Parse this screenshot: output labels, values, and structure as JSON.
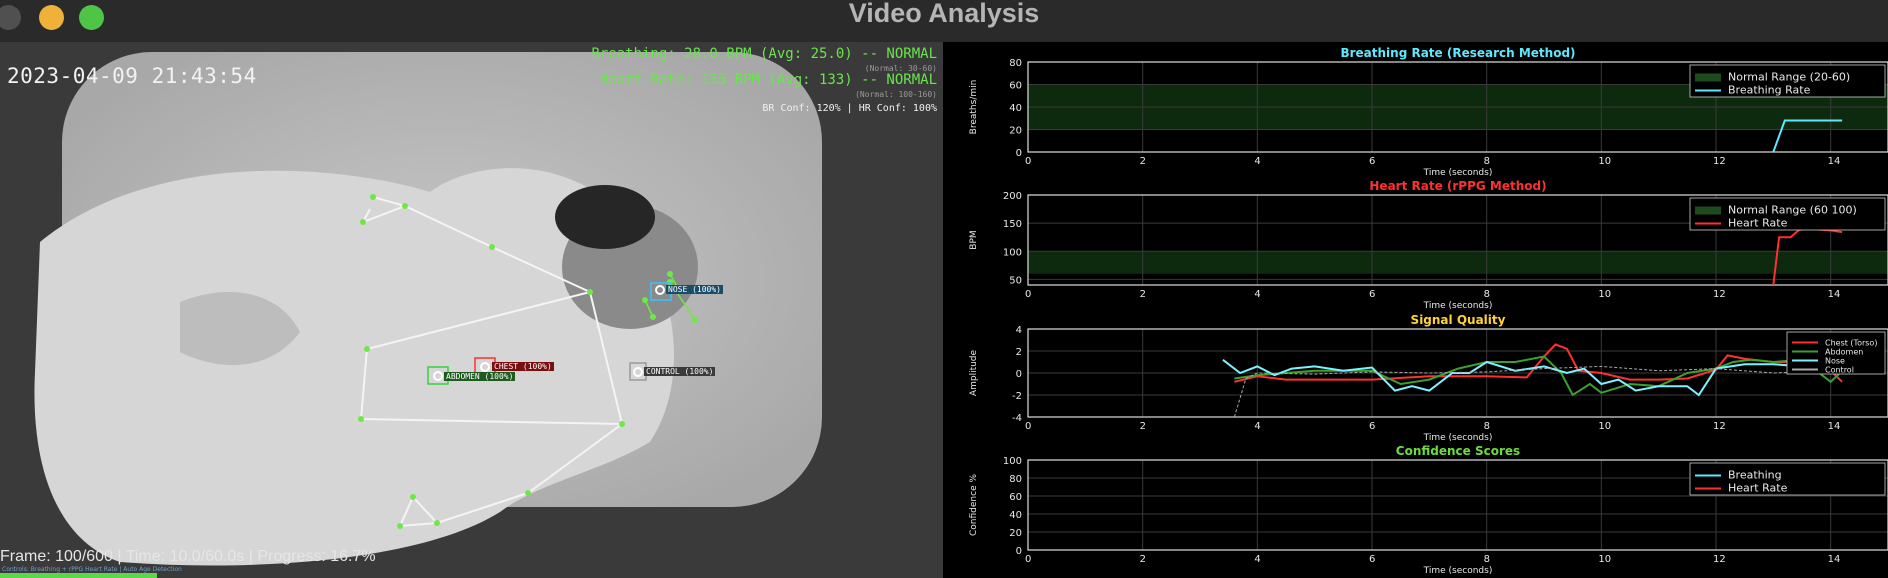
{
  "window": {
    "title": "Video Analysis"
  },
  "video": {
    "timestamp": "2023-04-09 21:43:54",
    "breathing_line": "Breathing: 28.0 BPM (Avg: 25.0) -- NORMAL",
    "breathing_normal": "(Normal: 30-60)",
    "heart_line": "Heart Rate: 133 BPM (Avg: 133) -- NORMAL",
    "heart_normal": "(Normal: 100-160)",
    "confidence_line": "BR Conf: 120%  |  HR Conf: 100%",
    "frame_info": "Frame: 100/600 | Time: 10.0/60.0s | Progress: 16.7%",
    "footnote": "Controls: Breathing + rPPG Heart Rate | Auto Age Detection",
    "progress": 0.167,
    "tags": {
      "nose": "NOSE (100%)",
      "chest": "CHEST (100%)",
      "abdomen": "ABDOMEN (100%)",
      "control": "CONTROL (100%)"
    }
  },
  "charts": {
    "chart_data": [
      {
        "type": "line",
        "title": "Breathing Rate (Research Method)",
        "xlabel": "Time (seconds)",
        "ylabel": "Breaths/min",
        "xlim": [
          0,
          15
        ],
        "ylim": [
          0,
          80
        ],
        "xticks": [
          0,
          2,
          4,
          6,
          8,
          10,
          12,
          14
        ],
        "yticks": [
          0,
          20,
          40,
          60,
          80
        ],
        "band": {
          "label": "Normal Range (20-60)",
          "from": 20,
          "to": 60
        },
        "series": [
          {
            "name": "Breathing Rate",
            "color": "#5ee8ff",
            "x": [
              13.0,
              13.2,
              13.5,
              14.2
            ],
            "y": [
              0,
              28,
              28,
              28
            ]
          }
        ],
        "legend": "top-right",
        "title_color": "#5ee8ff"
      },
      {
        "type": "line",
        "title": "Heart Rate (rPPG Method)",
        "xlabel": "Time (seconds)",
        "ylabel": "BPM",
        "xlim": [
          0,
          15
        ],
        "ylim": [
          40,
          200
        ],
        "xticks": [
          0,
          2,
          4,
          6,
          8,
          10,
          12,
          14
        ],
        "yticks": [
          50,
          100,
          150,
          200
        ],
        "band": {
          "label": "Normal Range (60 100)",
          "from": 60,
          "to": 100
        },
        "series": [
          {
            "name": "Heart Rate",
            "color": "#ff3030",
            "x": [
              13.0,
              13.1,
              13.3,
              13.45,
              13.6,
              14.0,
              14.2
            ],
            "y": [
              40,
              125,
              125,
              138,
              140,
              137,
              134
            ]
          }
        ],
        "legend": "top-right",
        "title_color": "#ff3030"
      },
      {
        "type": "line",
        "title": "Signal Quality",
        "xlabel": "Time (seconds)",
        "ylabel": "Amplitude",
        "xlim": [
          0,
          15
        ],
        "ylim": [
          -4,
          4
        ],
        "xticks": [
          0,
          2,
          4,
          6,
          8,
          10,
          12,
          14
        ],
        "yticks": [
          -4,
          -2,
          0,
          2,
          4
        ],
        "series": [
          {
            "name": "Chest (Torso)",
            "color": "#ff3030",
            "x": [
              3.6,
              4.0,
              4.5,
              5.0,
              6.0,
              7.0,
              8.0,
              8.7,
              9.0,
              9.2,
              9.4,
              9.6,
              10.0,
              10.5,
              11.0,
              11.5,
              12.0,
              12.2,
              12.5,
              13.0,
              13.5,
              14.0,
              14.2
            ],
            "y": [
              -0.8,
              -0.3,
              -0.6,
              -0.6,
              -0.6,
              -0.3,
              -0.3,
              -0.4,
              1.5,
              2.6,
              2.2,
              0.2,
              0.0,
              -0.6,
              -0.6,
              -0.5,
              0.3,
              1.6,
              1.3,
              1.0,
              1.0,
              0.2,
              -0.8
            ]
          },
          {
            "name": "Abdomen",
            "color": "#3aa030",
            "x": [
              3.6,
              4.0,
              4.5,
              5.0,
              6.0,
              6.5,
              7.0,
              7.5,
              8.0,
              8.5,
              9.0,
              9.3,
              9.5,
              9.8,
              10.0,
              10.5,
              11.0,
              11.5,
              12.0,
              12.3,
              12.6,
              13.0,
              13.5,
              14.0,
              14.2
            ],
            "y": [
              -0.5,
              -0.2,
              0.0,
              0.2,
              0.2,
              -1.0,
              -0.6,
              0.4,
              1.0,
              1.0,
              1.5,
              0.0,
              -2.0,
              -1.0,
              -1.8,
              -1.0,
              -1.2,
              0.0,
              0.4,
              1.0,
              1.2,
              1.0,
              1.2,
              -0.8,
              0.2
            ]
          },
          {
            "name": "Nose",
            "color": "#7df2ff",
            "x": [
              3.4,
              3.7,
              4.0,
              4.3,
              4.6,
              5.0,
              5.5,
              6.0,
              6.4,
              6.7,
              7.0,
              7.4,
              7.7,
              8.0,
              8.5,
              9.0,
              9.4,
              9.7,
              10.0,
              10.3,
              10.6,
              11.0,
              11.5,
              11.7,
              12.0,
              12.5,
              13.0,
              13.5,
              14.0,
              14.2
            ],
            "y": [
              1.2,
              0.0,
              0.6,
              -0.2,
              0.4,
              0.6,
              0.2,
              0.5,
              -1.6,
              -1.2,
              -1.6,
              0.0,
              0.0,
              1.0,
              0.2,
              0.6,
              0.0,
              0.4,
              -1.0,
              -0.6,
              -1.6,
              -1.2,
              -1.2,
              -2.0,
              0.4,
              0.8,
              0.8,
              0.6,
              0.4,
              0.8
            ]
          },
          {
            "name": "Control",
            "color": "#aaaaaa",
            "x": [
              3.6,
              3.8,
              4.0,
              5.0,
              6.0,
              7.0,
              8.0,
              9.0,
              10.0,
              11.0,
              12.0,
              13.0,
              14.0
            ],
            "y": [
              -4.0,
              -0.5,
              0.0,
              -0.1,
              0.1,
              0.0,
              0.1,
              0.4,
              0.6,
              0.2,
              0.4,
              0.0,
              0.2
            ]
          }
        ],
        "legend": "top-right",
        "title_color": "#ffd23a"
      },
      {
        "type": "line",
        "title": "Confidence Scores",
        "xlabel": "Time (seconds)",
        "ylabel": "Confidence %",
        "xlim": [
          0,
          15
        ],
        "ylim": [
          0,
          100
        ],
        "xticks": [
          0,
          2,
          4,
          6,
          8,
          10,
          12,
          14
        ],
        "yticks": [
          0,
          20,
          40,
          60,
          80,
          100
        ],
        "series": [
          {
            "name": "Breathing",
            "color": "#5ee8ff",
            "x": [],
            "y": []
          },
          {
            "name": "Heart Rate",
            "color": "#ff3030",
            "x": [],
            "y": []
          }
        ],
        "legend": "top-right",
        "title_color": "#6bdc3a"
      }
    ]
  }
}
